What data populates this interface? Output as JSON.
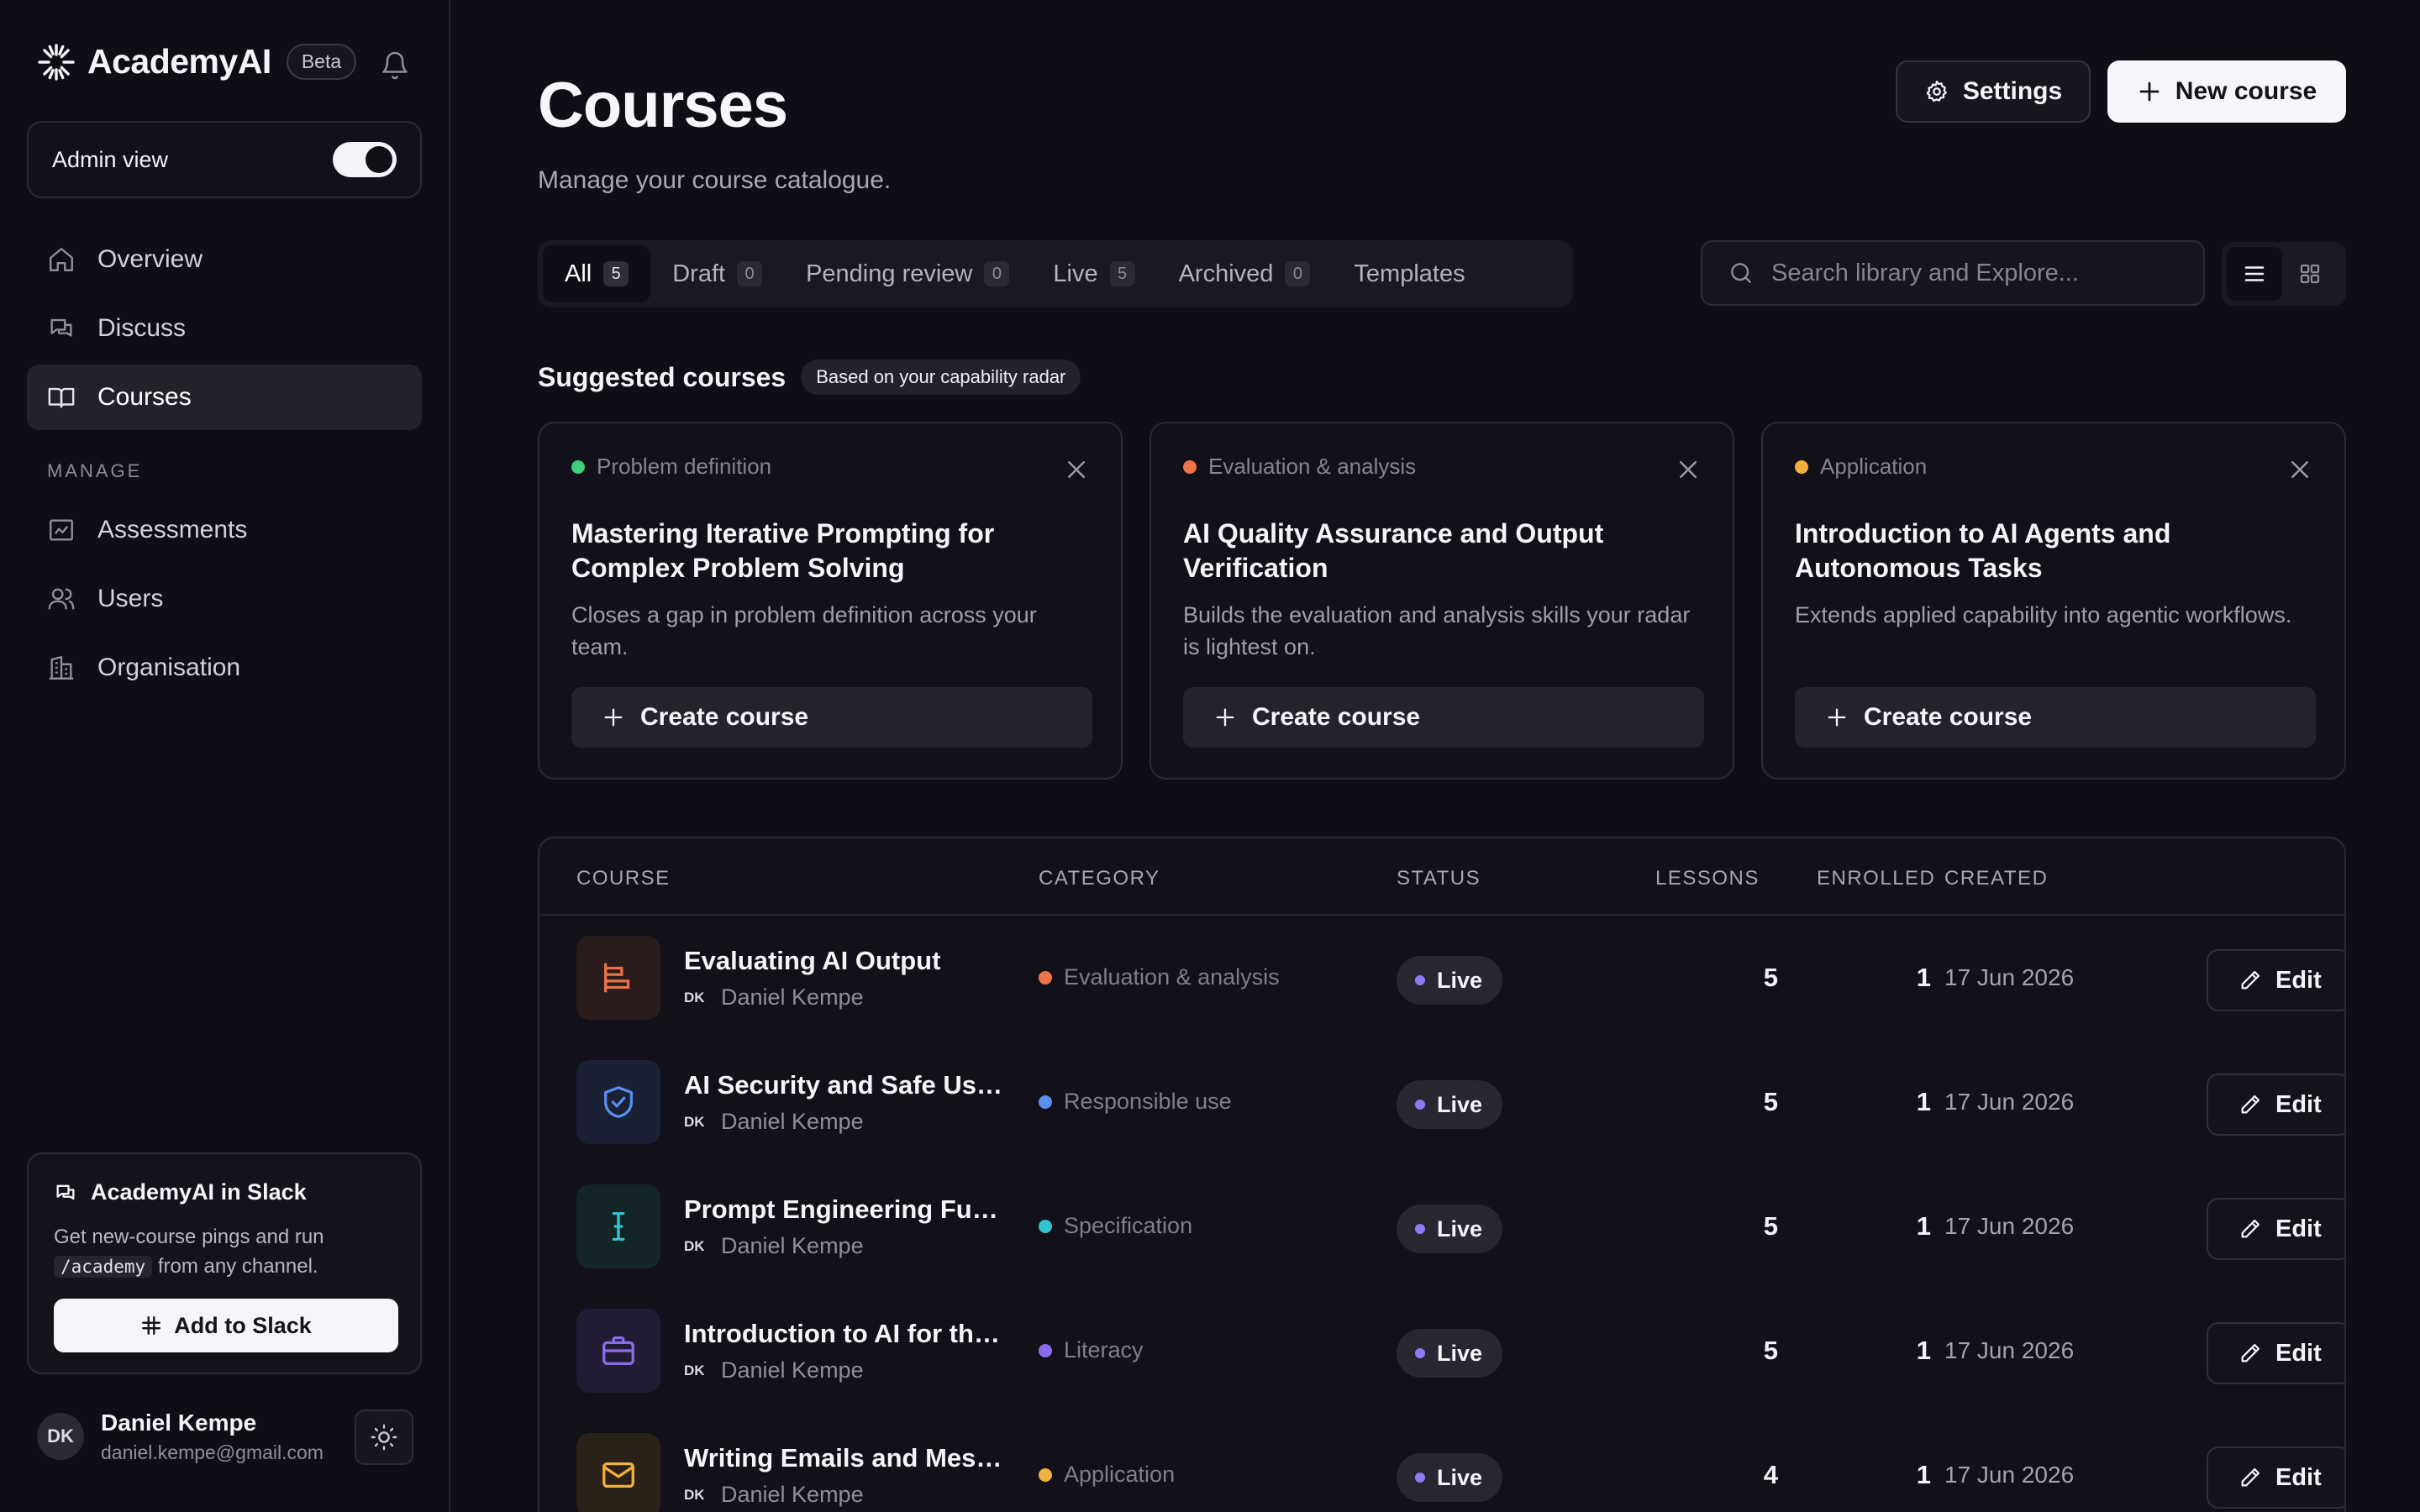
{
  "app": {
    "name": "AcademyAI",
    "badge": "Beta"
  },
  "sidebar": {
    "admin_label": "Admin view",
    "admin_enabled": true,
    "nav": [
      {
        "label": "Overview",
        "icon": "home-icon"
      },
      {
        "label": "Discuss",
        "icon": "chat-icon"
      },
      {
        "label": "Courses",
        "icon": "book-icon",
        "active": true
      }
    ],
    "manage_label": "MANAGE",
    "manage": [
      {
        "label": "Assessments",
        "icon": "chart-icon"
      },
      {
        "label": "Users",
        "icon": "users-icon"
      },
      {
        "label": "Organisation",
        "icon": "building-icon"
      }
    ],
    "slack": {
      "title": "AcademyAI in Slack",
      "desc_before": "Get new-course pings and run",
      "command": "/academy",
      "desc_after": "from any channel.",
      "button": "Add to Slack"
    },
    "user": {
      "initials": "DK",
      "name": "Daniel Kempe",
      "email": "daniel.kempe@gmail.com"
    }
  },
  "header": {
    "title": "Courses",
    "subtitle": "Manage your course catalogue.",
    "settings_label": "Settings",
    "new_label": "New course"
  },
  "tabs": [
    {
      "label": "All",
      "count": "5",
      "active": true
    },
    {
      "label": "Draft",
      "count": "0"
    },
    {
      "label": "Pending review",
      "count": "0"
    },
    {
      "label": "Live",
      "count": "5"
    },
    {
      "label": "Archived",
      "count": "0"
    },
    {
      "label": "Templates",
      "count": null
    }
  ],
  "search": {
    "placeholder": "Search library and Explore..."
  },
  "suggested": {
    "title": "Suggested courses",
    "badge": "Based on your capability radar",
    "button_label": "Create course",
    "cards": [
      {
        "category": "Problem definition",
        "color": "#3ecf7a",
        "title": "Mastering Iterative Prompting for Complex Problem Solving",
        "desc": "Closes a gap in problem definition across your team."
      },
      {
        "category": "Evaluation & analysis",
        "color": "#f0744a",
        "title": "AI Quality Assurance and Output Verification",
        "desc": "Builds the evaluation and analysis skills your radar is lightest on."
      },
      {
        "category": "Application",
        "color": "#f2b03c",
        "title": "Introduction to AI Agents and Autonomous Tasks",
        "desc": "Extends applied capability into agentic workflows."
      }
    ]
  },
  "table": {
    "headers": {
      "course": "COURSE",
      "category": "CATEGORY",
      "status": "STATUS",
      "lessons": "LESSONS",
      "enrolled": "ENROLLED",
      "created": "CREATED"
    },
    "edit_label": "Edit",
    "rows": [
      {
        "title": "Evaluating AI Output",
        "author_initials": "DK",
        "author": "Daniel Kempe",
        "category": "Evaluation & analysis",
        "cat_color": "#f0744a",
        "status": "Live",
        "lessons": "5",
        "enrolled": "1",
        "created": "17 Jun 2026",
        "icon": "bar-chart-icon",
        "icon_color": "#e8714a",
        "icon_bg": "#2a1c1c"
      },
      {
        "title": "AI Security and Safe Use of AI",
        "author_initials": "DK",
        "author": "Daniel Kempe",
        "category": "Responsible use",
        "cat_color": "#5b8ef0",
        "status": "Live",
        "lessons": "5",
        "enrolled": "1",
        "created": "17 Jun 2026",
        "icon": "shield-check-icon",
        "icon_color": "#5b8ef0",
        "icon_bg": "#1b2134"
      },
      {
        "title": "Prompt Engineering Fundamentals",
        "author_initials": "DK",
        "author": "Daniel Kempe",
        "category": "Specification",
        "cat_color": "#2fc5cf",
        "status": "Live",
        "lessons": "5",
        "enrolled": "1",
        "created": "17 Jun 2026",
        "icon": "text-cursor-icon",
        "icon_color": "#2fc5cf",
        "icon_bg": "#142528"
      },
      {
        "title": "Introduction to AI for the Workplace",
        "author_initials": "DK",
        "author": "Daniel Kempe",
        "category": "Literacy",
        "cat_color": "#8b6cf0",
        "status": "Live",
        "lessons": "5",
        "enrolled": "1",
        "created": "17 Jun 2026",
        "icon": "briefcase-icon",
        "icon_color": "#8b6cf0",
        "icon_bg": "#211c34"
      },
      {
        "title": "Writing Emails and Messages with AI",
        "author_initials": "DK",
        "author": "Daniel Kempe",
        "category": "Application",
        "cat_color": "#f2b03c",
        "status": "Live",
        "lessons": "4",
        "enrolled": "1",
        "created": "17 Jun 2026",
        "icon": "mail-icon",
        "icon_color": "#f2b03c",
        "icon_bg": "#2a2218"
      }
    ]
  },
  "colors": {
    "live_dot": "#8b7cf6",
    "accent_bg": "#0f0e17"
  }
}
